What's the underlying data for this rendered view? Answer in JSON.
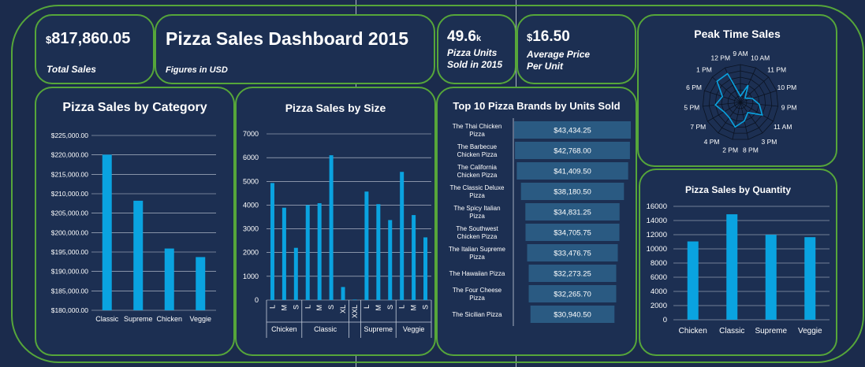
{
  "header": {
    "total_sales_currency": "$",
    "total_sales_value": "817,860.05",
    "total_sales_label": "Total Sales",
    "title": "Pizza Sales Dashboard 2015",
    "subtitle": "Figures in USD",
    "units_value": "49.6",
    "units_suffix": "k",
    "units_label_1": "Pizza Units",
    "units_label_2": "Sold in 2015",
    "avg_price_currency": "$",
    "avg_price_value": "16.50",
    "avg_price_label_1": "Average Price",
    "avg_price_label_2": "Per Unit"
  },
  "colors": {
    "bar": "#0aa3e0",
    "border": "#56a63a",
    "panel": "#1c2f52",
    "background": "#1b2b4c",
    "funnel": "#2a5a82"
  },
  "chart_data": [
    {
      "id": "category",
      "type": "bar",
      "title": "Pizza Sales by Category",
      "categories": [
        "Classic",
        "Supreme",
        "Chicken",
        "Veggie"
      ],
      "values": [
        220050,
        208200,
        195900,
        193700
      ],
      "ylim": [
        180000,
        225000
      ],
      "yticks": [
        "$180,000.00",
        "$185,000.00",
        "$190,000.00",
        "$195,000.00",
        "$200,000.00",
        "$205,000.00",
        "$210,000.00",
        "$215,000.00",
        "$220,000.00",
        "$225,000.00"
      ],
      "grid": true
    },
    {
      "id": "size",
      "type": "bar",
      "title": "Pizza Sales by Size",
      "groups": [
        {
          "name": "Chicken",
          "sizes": [
            "L",
            "M",
            "S"
          ],
          "values": [
            4930,
            3890,
            2200
          ]
        },
        {
          "name": "Classic",
          "sizes": [
            "L",
            "M",
            "S",
            "XL"
          ],
          "values": [
            4000,
            4080,
            6100,
            550
          ]
        },
        {
          "name": "",
          "sizes": [
            "XXL"
          ],
          "values": [
            20
          ]
        },
        {
          "name": "Supreme",
          "sizes": [
            "L",
            "M",
            "S"
          ],
          "values": [
            4570,
            4040,
            3370
          ]
        },
        {
          "name": "Veggie",
          "sizes": [
            "L",
            "M",
            "S"
          ],
          "values": [
            5400,
            3580,
            2640
          ]
        }
      ],
      "ylim": [
        0,
        7000
      ],
      "yticks": [
        "0",
        "1000",
        "2000",
        "3000",
        "4000",
        "5000",
        "6000",
        "7000"
      ],
      "grid": true
    },
    {
      "id": "top10",
      "type": "bar",
      "orientation": "horizontal-funnel",
      "title": "Top 10 Pizza Brands by Units Sold",
      "categories": [
        "The Thai Chicken Pizza",
        "The Barbecue Chicken Pizza",
        "The California Chicken Pizza",
        "The Classic Deluxe Pizza",
        "The Spicy Italian Pizza",
        "The Southwest Chicken Pizza",
        "The Italian Supreme Pizza",
        "The Hawaiian Pizza",
        "The Four Cheese Pizza",
        "The Sicilian Pizza"
      ],
      "values": [
        43434.25,
        42768.0,
        41409.5,
        38180.5,
        34831.25,
        34705.75,
        33476.75,
        32273.25,
        32265.7,
        30940.5
      ],
      "labels": [
        "$43,434.25",
        "$42,768.00",
        "$41,409.50",
        "$38,180.50",
        "$34,831.25",
        "$34,705.75",
        "$33,476.75",
        "$32,273.25",
        "$32,265.70",
        "$30,940.50"
      ]
    },
    {
      "id": "peak",
      "type": "radar",
      "title": "Peak Time Sales",
      "categories": [
        "9 AM",
        "10 AM",
        "11 PM",
        "10 PM",
        "9 PM",
        "11 AM",
        "3 PM",
        "8 PM",
        "2 PM",
        "4 PM",
        "7 PM",
        "5 PM",
        "6 PM",
        "1 PM",
        "12 PM"
      ],
      "values": [
        1,
        3,
        1,
        2,
        3,
        4,
        2,
        3,
        4,
        3,
        3,
        4,
        3,
        5,
        5
      ],
      "max": 6
    },
    {
      "id": "quantity",
      "type": "bar",
      "title": "Pizza Sales by Quantity",
      "categories": [
        "Chicken",
        "Classic",
        "Supreme",
        "Veggie"
      ],
      "values": [
        11050,
        14880,
        11990,
        11650
      ],
      "ylim": [
        0,
        16000
      ],
      "yticks": [
        "0",
        "2000",
        "4000",
        "6000",
        "8000",
        "10000",
        "12000",
        "14000",
        "16000"
      ],
      "grid": true
    }
  ]
}
